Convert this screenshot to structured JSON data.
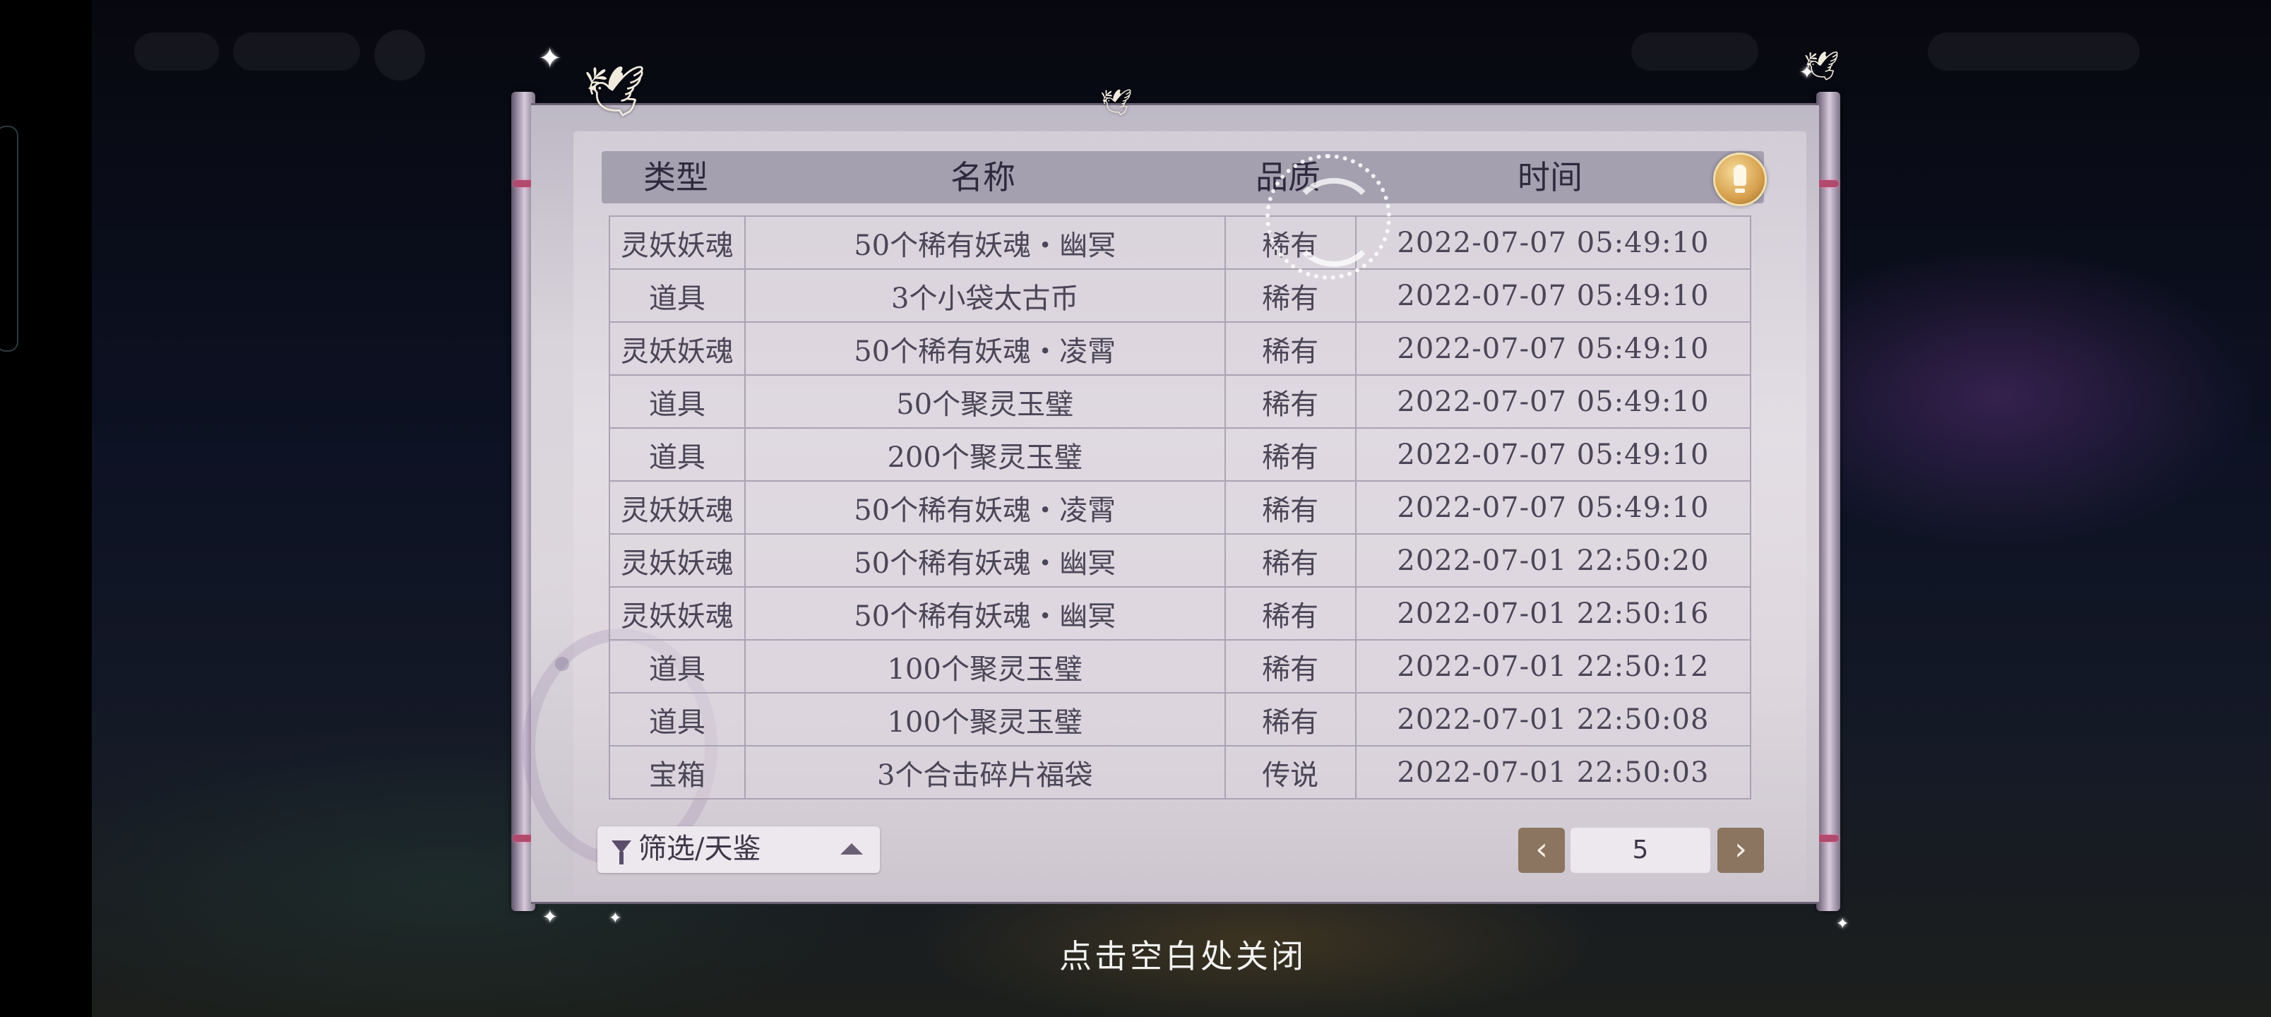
{
  "headers": {
    "type": "类型",
    "name": "名称",
    "quality": "品质",
    "time": "时间"
  },
  "rows": [
    {
      "type": "灵妖妖魂",
      "name": "50个稀有妖魂・幽冥",
      "quality": "稀有",
      "tier": "rare",
      "time": "2022-07-07  05:49:10"
    },
    {
      "type": "道具",
      "name": "3个小袋太古币",
      "quality": "稀有",
      "tier": "rare",
      "time": "2022-07-07  05:49:10"
    },
    {
      "type": "灵妖妖魂",
      "name": "50个稀有妖魂・凌霄",
      "quality": "稀有",
      "tier": "rare",
      "time": "2022-07-07  05:49:10"
    },
    {
      "type": "道具",
      "name": "50个聚灵玉璧",
      "quality": "稀有",
      "tier": "rare",
      "time": "2022-07-07  05:49:10"
    },
    {
      "type": "道具",
      "name": "200个聚灵玉璧",
      "quality": "稀有",
      "tier": "rare",
      "time": "2022-07-07  05:49:10"
    },
    {
      "type": "灵妖妖魂",
      "name": "50个稀有妖魂・凌霄",
      "quality": "稀有",
      "tier": "rare",
      "time": "2022-07-07  05:49:10"
    },
    {
      "type": "灵妖妖魂",
      "name": "50个稀有妖魂・幽冥",
      "quality": "稀有",
      "tier": "rare",
      "time": "2022-07-01  22:50:20"
    },
    {
      "type": "灵妖妖魂",
      "name": "50个稀有妖魂・幽冥",
      "quality": "稀有",
      "tier": "rare",
      "time": "2022-07-01  22:50:16"
    },
    {
      "type": "道具",
      "name": "100个聚灵玉璧",
      "quality": "稀有",
      "tier": "rare",
      "time": "2022-07-01  22:50:12"
    },
    {
      "type": "道具",
      "name": "100个聚灵玉璧",
      "quality": "稀有",
      "tier": "rare",
      "time": "2022-07-01  22:50:08"
    },
    {
      "type": "宝箱",
      "name": "3个合击碎片福袋",
      "quality": "传说",
      "tier": "legendary",
      "time": "2022-07-01  22:50:03"
    }
  ],
  "filter": {
    "label": "筛选/天鉴",
    "icon": "funnel-icon"
  },
  "pagination": {
    "prev": "‹",
    "next": "›",
    "page": "5"
  },
  "close_hint": "点击空白处关闭",
  "colors": {
    "rare": "#7b3fc8",
    "legendary": "#c65b2e",
    "header_bg": "#a5a0b0"
  }
}
